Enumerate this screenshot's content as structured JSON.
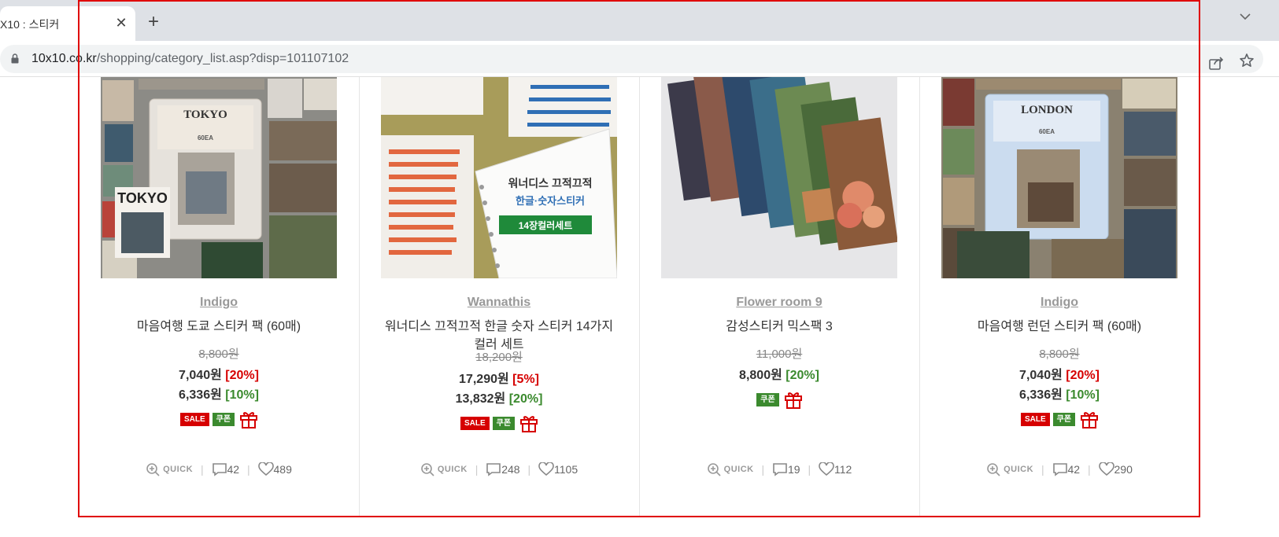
{
  "browser": {
    "tab_title": "X10 : 스티커",
    "tab_close": "✕",
    "new_tab": "+",
    "url_host": "10x10.co.kr",
    "url_path": "/shopping/category_list.asp?disp=101107102"
  },
  "products": [
    {
      "brand": "Indigo",
      "name": "마음여행 도쿄 스티커 팩 (60매)",
      "original_price": "8,800원",
      "prices": [
        {
          "amount": "7,040원",
          "discount": "[20%]",
          "color": "#d60000"
        },
        {
          "amount": "6,336원",
          "discount": "[10%]",
          "color": "#3b8a2e"
        }
      ],
      "badges": [
        "SALE",
        "쿠폰"
      ],
      "gift": true,
      "quick": "QUICK",
      "reviews": "42",
      "likes": "489",
      "image_text": [
        "TOKYO",
        "TOKYO",
        "60EA"
      ]
    },
    {
      "brand": "Wannathis",
      "name": "워너디스 끄적끄적 한글 숫자 스티커 14가지 컬러 세트",
      "original_price": "18,200원",
      "prices": [
        {
          "amount": "17,290원",
          "discount": "[5%]",
          "color": "#d60000"
        },
        {
          "amount": "13,832원",
          "discount": "[20%]",
          "color": "#3b8a2e"
        }
      ],
      "badges": [
        "SALE",
        "쿠폰"
      ],
      "gift": true,
      "quick": "QUICK",
      "reviews": "248",
      "likes": "1105",
      "image_text": [
        "워너디스 끄적끄적",
        "한글·숫자스티커",
        "14장컬러세트"
      ]
    },
    {
      "brand": "Flower room 9",
      "name": "감성스티커 믹스팩 3",
      "original_price": "11,000원",
      "prices": [
        {
          "amount": "8,800원",
          "discount": "[20%]",
          "color": "#3b8a2e"
        }
      ],
      "badges": [
        "쿠폰"
      ],
      "gift": true,
      "quick": "QUICK",
      "reviews": "19",
      "likes": "112",
      "image_text": []
    },
    {
      "brand": "Indigo",
      "name": "마음여행 런던 스티커 팩 (60매)",
      "original_price": "8,800원",
      "prices": [
        {
          "amount": "7,040원",
          "discount": "[20%]",
          "color": "#d60000"
        },
        {
          "amount": "6,336원",
          "discount": "[10%]",
          "color": "#3b8a2e"
        }
      ],
      "badges": [
        "SALE",
        "쿠폰"
      ],
      "gift": true,
      "quick": "QUICK",
      "reviews": "42",
      "likes": "290",
      "image_text": [
        "LONDON",
        "60EA"
      ]
    }
  ],
  "colors": {
    "sale_red": "#d60000",
    "coupon_green": "#3b8a2e",
    "highlight_box": "#e00000"
  },
  "icons": [
    "lock-icon",
    "share-icon",
    "star-icon",
    "gift-icon",
    "zoom-icon",
    "comment-icon",
    "heart-icon",
    "chevron-down-icon"
  ]
}
